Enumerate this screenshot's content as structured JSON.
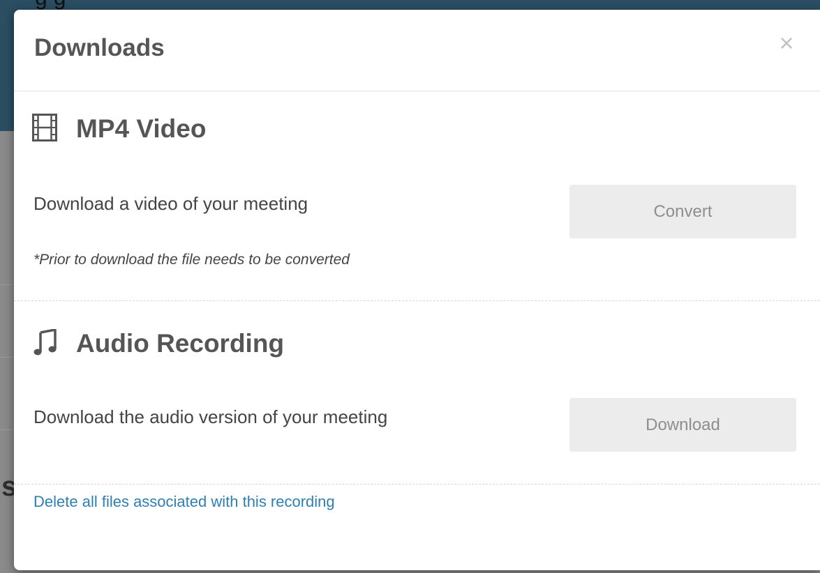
{
  "modal": {
    "title": "Downloads",
    "close_label": "×"
  },
  "sections": [
    {
      "icon": "film-icon",
      "title": "MP4 Video",
      "description": "Download a video of your meeting",
      "note": "*Prior to download the file needs to be converted",
      "button_label": "Convert"
    },
    {
      "icon": "music-note-icon",
      "title": "Audio Recording",
      "description": "Download the audio version of your meeting",
      "button_label": "Download"
    }
  ],
  "footer": {
    "delete_link": "Delete all files associated with this recording"
  },
  "colors": {
    "title_text": "#555555",
    "button_bg": "#ececec",
    "button_text": "#8e8e8e",
    "link": "#2f7fb1",
    "header_backdrop": "#2b4e63"
  }
}
